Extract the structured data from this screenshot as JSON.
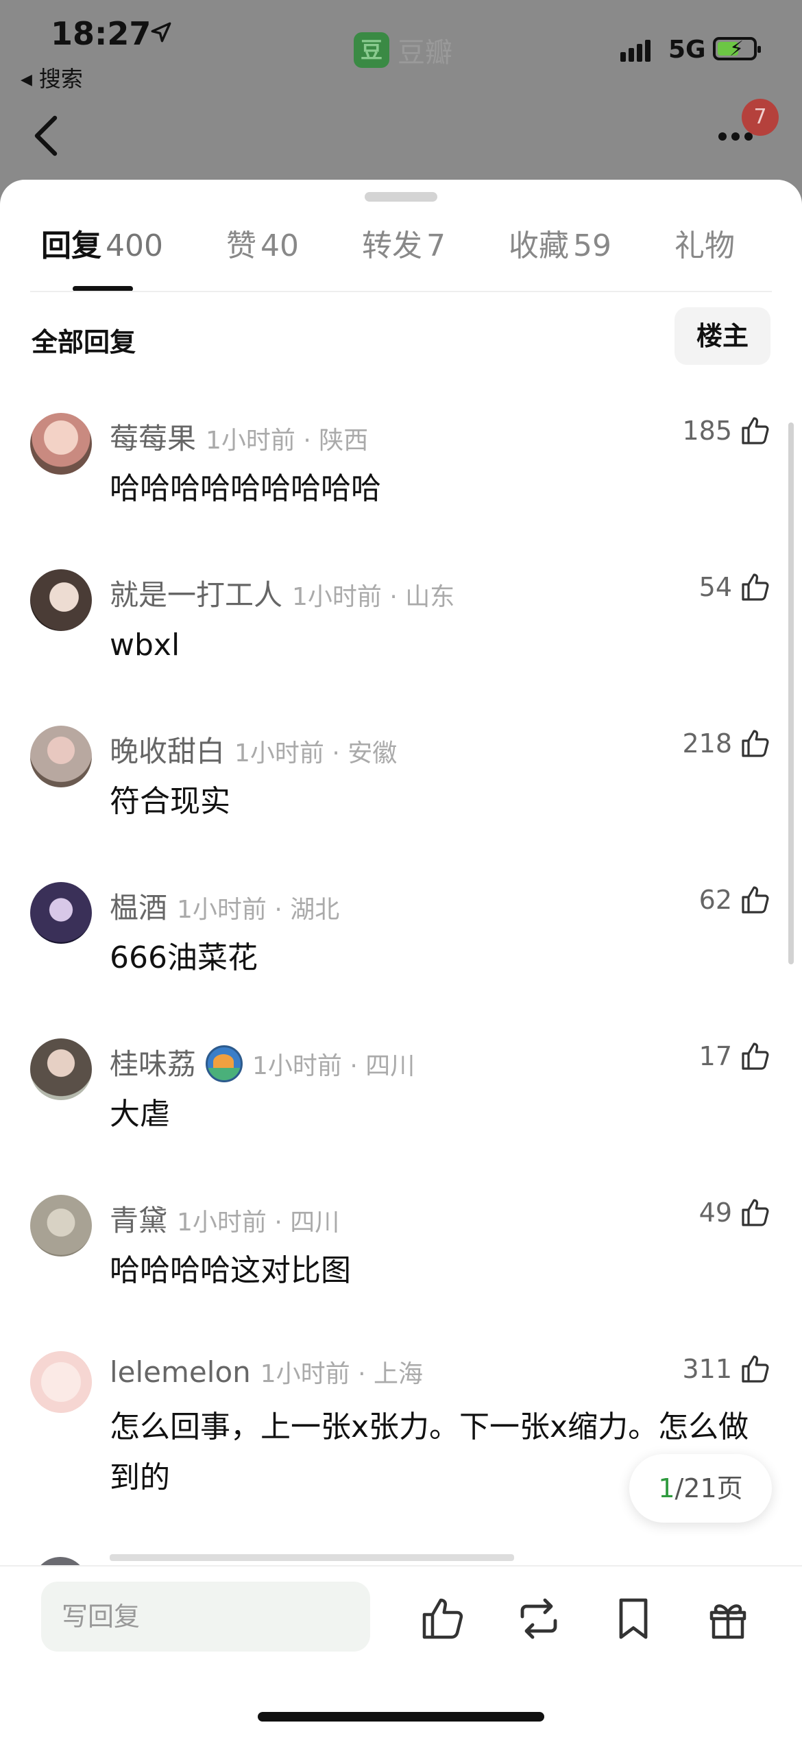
{
  "status_bar": {
    "time": "18:27",
    "back_app": "搜索",
    "network": "5G",
    "battery_charging": true,
    "app_name": "豆瓣"
  },
  "nav": {
    "badge_count": "7"
  },
  "tabs": [
    {
      "label": "回复",
      "count": "400",
      "active": true
    },
    {
      "label": "赞",
      "count": "40",
      "active": false
    },
    {
      "label": "转发",
      "count": "7",
      "active": false
    },
    {
      "label": "收藏",
      "count": "59",
      "active": false
    },
    {
      "label": "礼物",
      "count": "",
      "active": false
    }
  ],
  "filter": {
    "label": "全部回复",
    "op_button": "楼主"
  },
  "comments": [
    {
      "name": "莓莓果",
      "meta": "1小时前 · 陕西",
      "text": "哈哈哈哈哈哈哈哈哈",
      "likes": "185",
      "avatar_color": "#c98a80"
    },
    {
      "name": "就是一打工人",
      "meta": "1小时前 · 山东",
      "text": "wbxl",
      "likes": "54",
      "avatar_color": "#4a3c36"
    },
    {
      "name": "晚收甜白",
      "meta": "1小时前 · 安徽",
      "text": "符合现实",
      "likes": "218",
      "avatar_color": "#b8a8a0"
    },
    {
      "name": "榅酒",
      "meta": "1小时前 · 湖北",
      "text": "666油菜花",
      "likes": "62",
      "avatar_color": "#3a3058"
    },
    {
      "name": "桂味荔",
      "meta": "1小时前 · 四川",
      "text": "大虐",
      "likes": "17",
      "avatar_color": "#5a5048",
      "medal": true
    },
    {
      "name": "青黛",
      "meta": "1小时前 · 四川",
      "text": "哈哈哈哈这对比图",
      "likes": "49",
      "avatar_color": "#a8a294"
    },
    {
      "name": "lelemelon",
      "meta": "1小时前 · 上海",
      "text": "怎么回事，上一张x张力。下一张x缩力。怎么做到的",
      "likes": "311",
      "avatar_color": "#f6d6d2"
    }
  ],
  "pagination": {
    "current": "1",
    "total_text": "/21页"
  },
  "bottom_bar": {
    "reply_placeholder": "写回复"
  },
  "colors": {
    "accent_green": "#2e9a3e",
    "badge_red": "#b5413c"
  }
}
